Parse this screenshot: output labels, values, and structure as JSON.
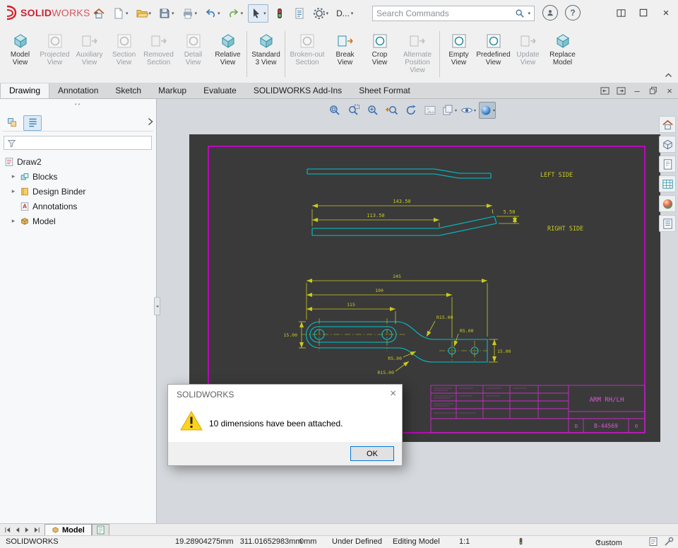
{
  "titlebar": {
    "logo_solid": "SOLID",
    "logo_works": "WORKS",
    "file_menu": "D...",
    "search_placeholder": "Search Commands"
  },
  "ribbon": {
    "buttons": [
      {
        "label": "Model View",
        "enabled": true
      },
      {
        "label": "Projected View",
        "enabled": false
      },
      {
        "label": "Auxiliary View",
        "enabled": false
      },
      {
        "label": "Section View",
        "enabled": false
      },
      {
        "label": "Removed Section",
        "enabled": false
      },
      {
        "label": "Detail View",
        "enabled": false
      },
      {
        "label": "Relative View",
        "enabled": true
      },
      {
        "label": "Standard 3 View",
        "enabled": true
      },
      {
        "label": "Broken-out Section",
        "enabled": false
      },
      {
        "label": "Break View",
        "enabled": true
      },
      {
        "label": "Crop View",
        "enabled": true
      },
      {
        "label": "Alternate Position View",
        "enabled": false
      },
      {
        "label": "Empty View",
        "enabled": true
      },
      {
        "label": "Predefined View",
        "enabled": true
      },
      {
        "label": "Update View",
        "enabled": false
      },
      {
        "label": "Replace Model",
        "enabled": true
      }
    ]
  },
  "tabs": {
    "drawing": "Drawing",
    "annotation": "Annotation",
    "sketch": "Sketch",
    "markup": "Markup",
    "evaluate": "Evaluate",
    "addins": "SOLIDWORKS Add-Ins",
    "sheet_format": "Sheet Format"
  },
  "tree": {
    "root": "Draw2",
    "blocks": "Blocks",
    "design_binder": "Design Binder",
    "annotations": "Annotations",
    "model": "Model"
  },
  "sheet": {
    "left_side": "LEFT SIDE",
    "right_side": "RIGHT SIDE",
    "dim_len1": "143.50",
    "dim_len2": "113.50",
    "dim_thk": "5.50",
    "dim_a": "245",
    "dim_b": "190",
    "dim_c": "115",
    "dim_w_left": "15.00",
    "dim_w_right": "15.00",
    "r15_top": "R15.00",
    "r5_top": "R5.00",
    "r5_bottom": "R5.00",
    "r15_bottom": "R15.00",
    "title_block": {
      "part_name": "ARM RH/LH",
      "size": "D",
      "drawing_number": "B-44569",
      "rev": "0"
    }
  },
  "dialog": {
    "title": "SOLIDWORKS",
    "message": "10 dimensions have been attached.",
    "ok": "OK"
  },
  "bottom_tabs": {
    "model": "Model"
  },
  "statusbar": {
    "app": "SOLIDWORKS",
    "coords": "19.28904275mm   311.01652983mm",
    "z": "0mm",
    "constraint": "Under Defined",
    "mode": "Editing Model",
    "scale": "1:1",
    "units": "Custom"
  }
}
